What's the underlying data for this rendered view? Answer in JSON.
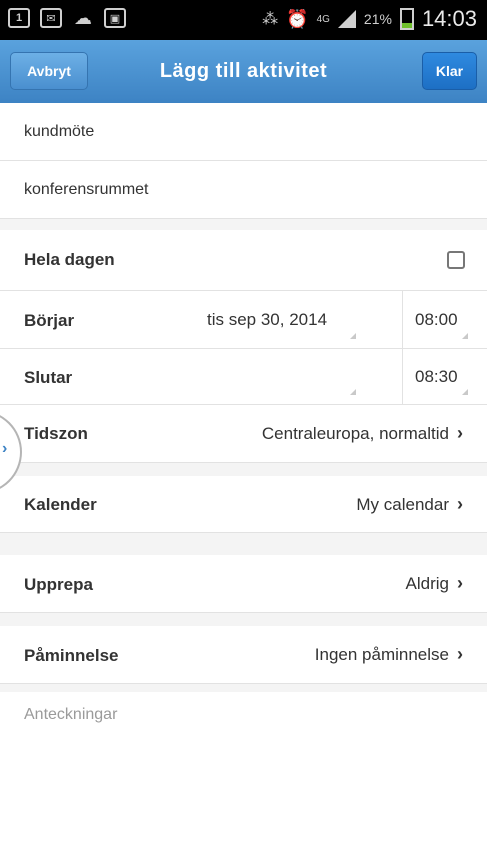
{
  "status_bar": {
    "network": "4G",
    "battery_percent": "21%",
    "time": "14:03"
  },
  "titlebar": {
    "cancel_label": "Avbryt",
    "title": "Lägg till aktivitet",
    "done_label": "Klar"
  },
  "form": {
    "title_value": "kundmöte",
    "location_value": "konferensrummet",
    "all_day": {
      "label": "Hela dagen",
      "checked": false
    },
    "start": {
      "label": "Börjar",
      "date": "tis sep 30, 2014",
      "time": "08:00"
    },
    "end": {
      "label": "Slutar",
      "time": "08:30"
    },
    "timezone": {
      "label": "Tidszon",
      "value": "Centraleuropa, normaltid"
    },
    "calendar": {
      "label": "Kalender",
      "value": "My calendar"
    },
    "repeat": {
      "label": "Upprepa",
      "value": "Aldrig"
    },
    "reminder": {
      "label": "Påminnelse",
      "value": "Ingen påminnelse"
    },
    "notes_placeholder": "Anteckningar"
  }
}
